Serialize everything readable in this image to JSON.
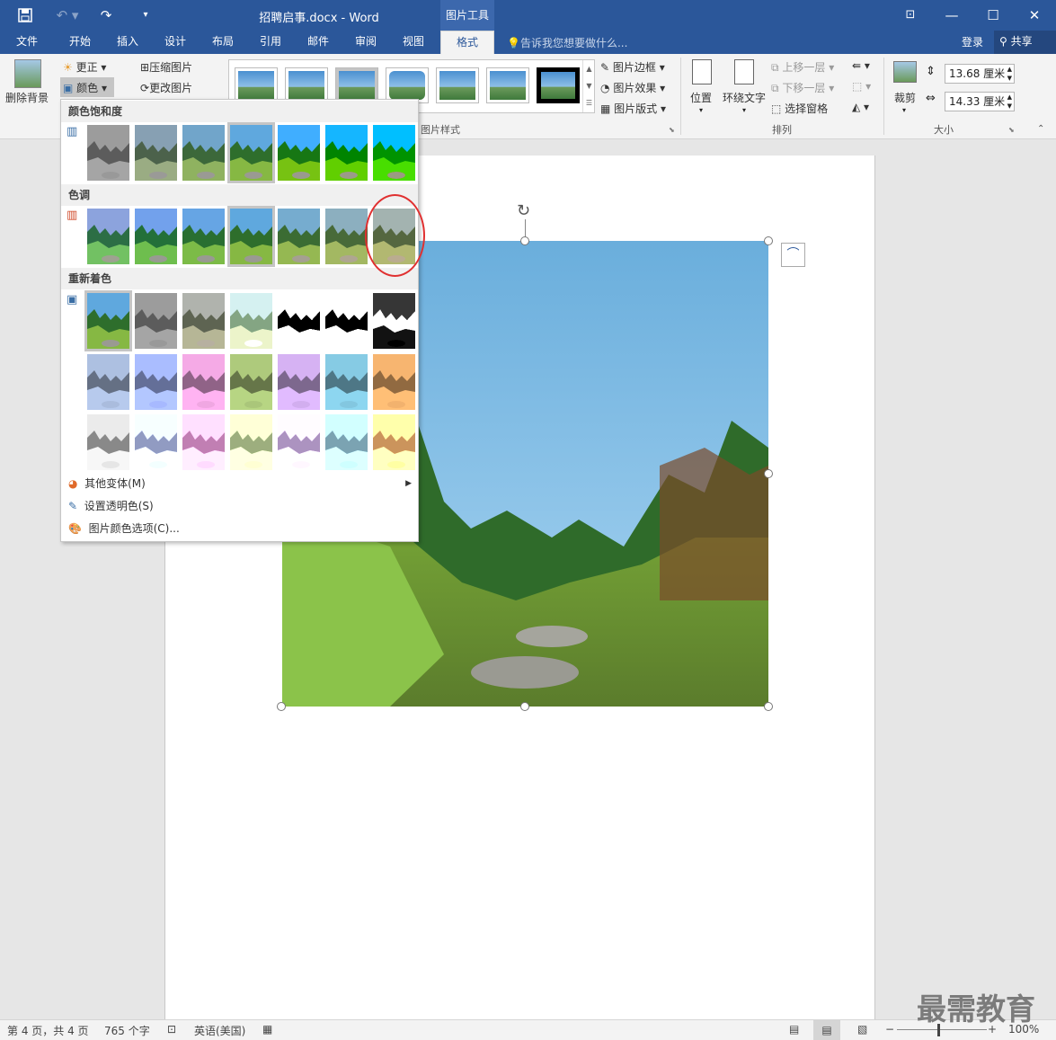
{
  "window": {
    "title": "招聘启事.docx - Word",
    "tools_header": "图片工具"
  },
  "tabs": [
    "文件",
    "开始",
    "插入",
    "设计",
    "布局",
    "引用",
    "邮件",
    "审阅",
    "视图",
    "格式"
  ],
  "active_tab": "格式",
  "tell_me": "告诉我您想要做什么...",
  "account": {
    "sign_in": "登录",
    "share": "共享"
  },
  "ribbon": {
    "remove_bg": "删除背景",
    "corrections": "更正",
    "color": "颜色",
    "compress": "压缩图片",
    "change": "更改图片",
    "styles_group": "图片样式",
    "border": "图片边框",
    "effects": "图片效果",
    "layout": "图片版式",
    "position": "位置",
    "wrap": "环绕文字",
    "bring_forward": "上移一层",
    "send_backward": "下移一层",
    "selection_pane": "选择窗格",
    "arrange_group": "排列",
    "crop": "裁剪",
    "height": "13.68 厘米",
    "width": "14.33 厘米",
    "size_group": "大小"
  },
  "color_menu": {
    "saturation_title": "颜色饱和度",
    "tone_title": "色调",
    "recolor_title": "重新着色",
    "more_variations": "其他变体(M)",
    "set_transparent": "设置透明色(S)",
    "color_options": "图片颜色选项(C)..."
  },
  "status": {
    "page": "第 4 页，共 4 页",
    "words": "765 个字",
    "language": "英语(美国)",
    "zoom": "100%"
  },
  "watermark": "最需教育",
  "colors": {
    "title_blue": "#2b579a",
    "highlight_circle": "#e03030"
  }
}
